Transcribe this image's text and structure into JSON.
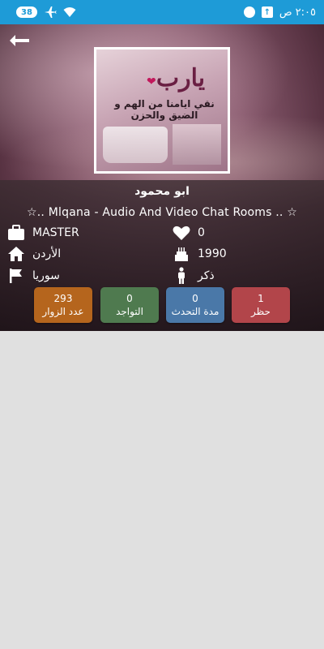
{
  "status_bar": {
    "battery": "38",
    "time": "٢:٠٥ ص",
    "upload_icon": "upload-icon",
    "chat_icon": "whatsapp-icon"
  },
  "header": {
    "back_icon": "back-arrow-icon"
  },
  "avatar": {
    "title": "يارب",
    "caption": "نقي ايامنا من الهم و الضيق والحزن"
  },
  "profile": {
    "name": "ابو محمود",
    "tagline": "☆.. Mlqana - Audio And Video Chat Rooms .. ☆",
    "rank": "MASTER",
    "likes": "0",
    "country": "الأردن",
    "birth_year": "1990",
    "city": "سوريا",
    "gender": "ذكر"
  },
  "stats": [
    {
      "value": "293",
      "label": "عدد الزوار",
      "color": "#b5651d"
    },
    {
      "value": "0",
      "label": "التواجد",
      "color": "#4f7a4f"
    },
    {
      "value": "0",
      "label": "مدة التحدث",
      "color": "#4a78a8"
    },
    {
      "value": "1",
      "label": "حظر",
      "color": "#b2454a"
    }
  ]
}
